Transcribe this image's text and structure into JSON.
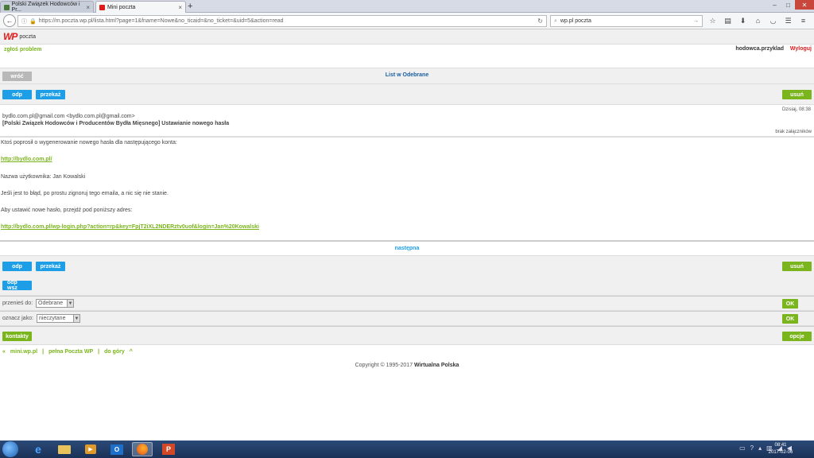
{
  "browser": {
    "tabs": [
      {
        "title": "Polski Związek Hodowców i Pr...",
        "active": false
      },
      {
        "title": "Mini poczta",
        "active": true
      }
    ],
    "url": "https://m.poczta.wp.pl/lista.html?page=1&fname=Nowe&no_ticaid=&no_ticket=&uid=5&action=read",
    "search_value": "wp.pl poczta"
  },
  "header": {
    "logo": "WP",
    "logo_text": "poczta"
  },
  "topbar": {
    "report_link": "zgłoś problem",
    "username": "hodowca.przyklad",
    "logout": "Wyloguj"
  },
  "nav": {
    "back_button": "wróć",
    "title": "List w Odebrane"
  },
  "actions": {
    "reply": "odp",
    "forward": "przekaż",
    "delete": "usuń",
    "reply_all": "odp wsz"
  },
  "message": {
    "date": "Dzisiaj, 08:38",
    "from": "bydlo.com.pl@gmail.com <bydlo.com.pl@gmail.com>",
    "subject": "[Polski Związek Hodowców i Producentów Bydła Mięsnego] Ustawianie nowego hasła",
    "attachments": "brak załączników",
    "line1": "Ktoś poprosił o wygenerowanie nowego hasła dla następującego konta:",
    "link1": "http://bydlo.com.pl/",
    "line2": "Nazwa użytkownika: Jan Kowalski",
    "line3": "Jeśli jest to błąd, po prostu zignoruj tego emaila, a nic się nie stanie.",
    "line4": "Aby ustawić nowe hasło, przejdź pod poniższy adres:",
    "link2": "http://bydlo.com.pl/wp-login.php?action=rp&key=FpjT2iXL2NDERztv0uof&login=Jan%20Kowalski"
  },
  "next_link": "następna",
  "move": {
    "label": "przenieś do:",
    "value": "Odebrane",
    "ok": "OK"
  },
  "mark": {
    "label": "oznacz jako:",
    "value": "nieczytane",
    "ok": "OK"
  },
  "bottom": {
    "contacts": "kontakty",
    "options": "opcje"
  },
  "footer": {
    "prev": "«",
    "link1": "mini.wp.pl",
    "sep1": "|",
    "link2": "pełna Poczta WP",
    "sep2": "|",
    "link3": "do góry",
    "up": "^",
    "copyright": "Copyright © 1995-2017",
    "company": "Wirtualna Polska"
  },
  "taskbar": {
    "time": "08:41",
    "date": "2017-02-06"
  },
  "colors": {
    "green": "#7ab51d",
    "blue": "#1d9ee6",
    "red": "#e01b1b",
    "title_blue": "#1a5fa0"
  }
}
